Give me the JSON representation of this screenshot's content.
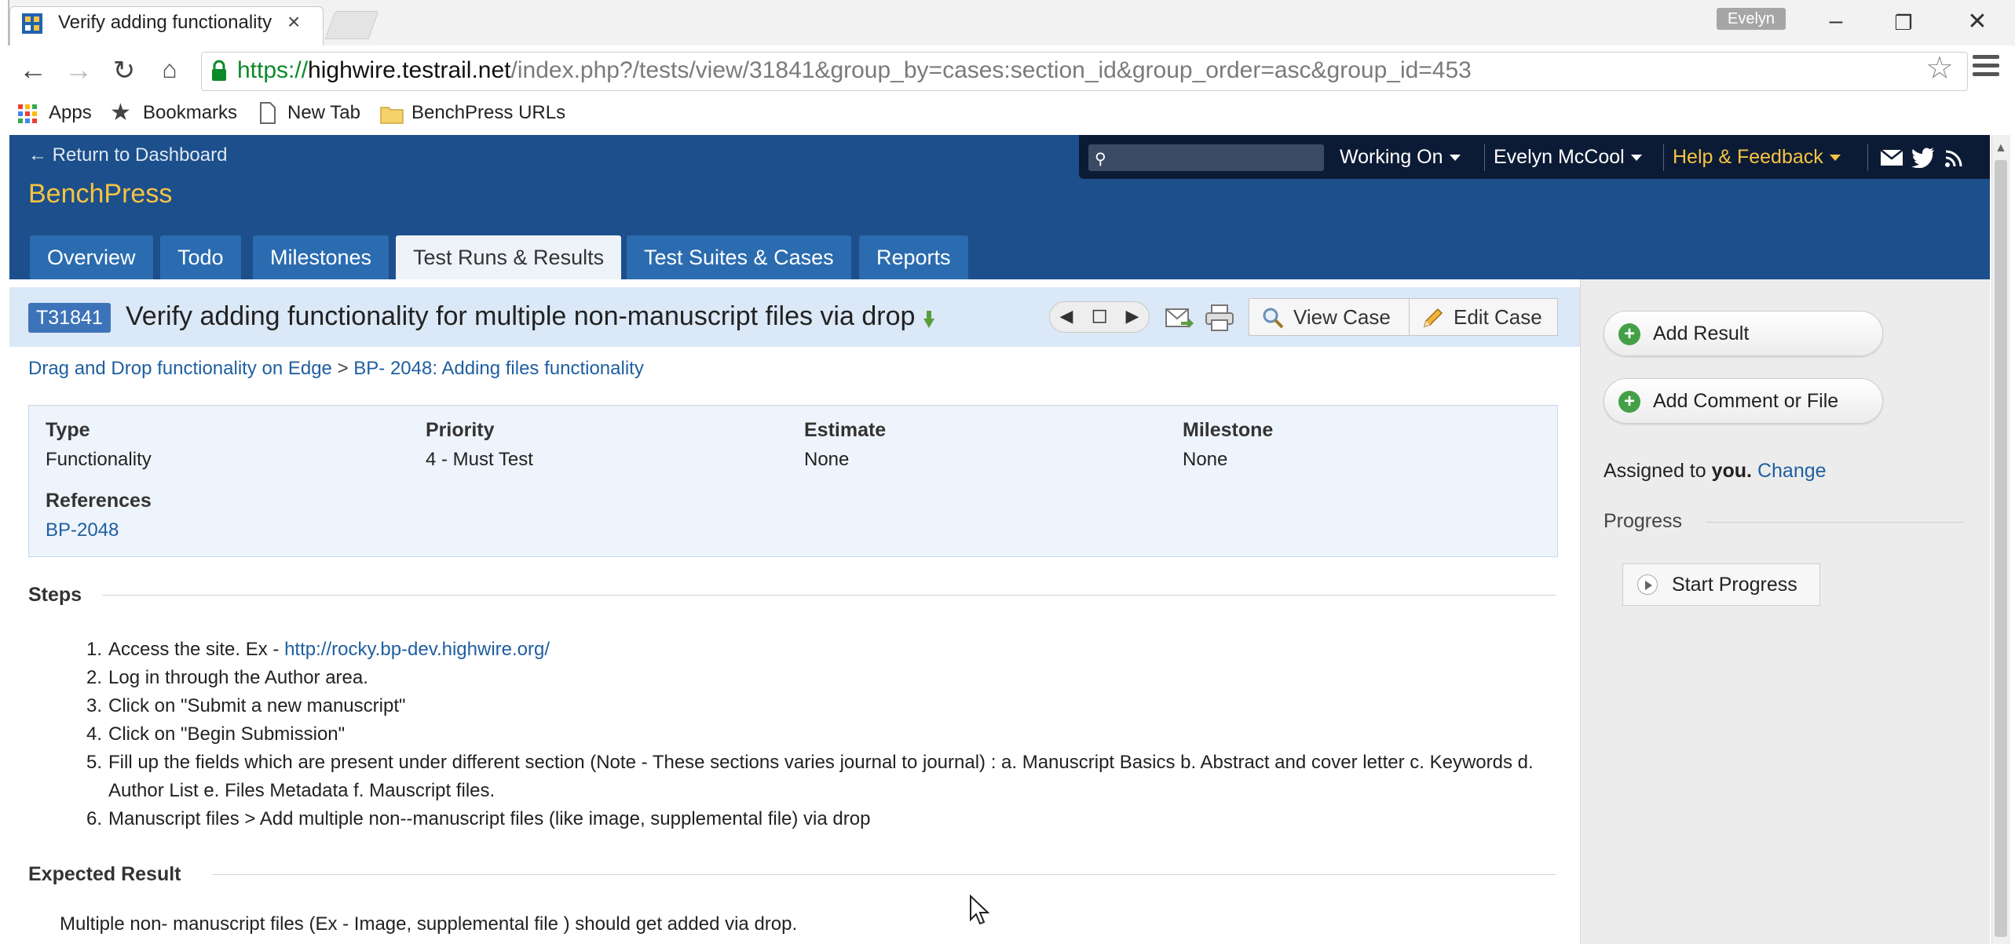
{
  "browser": {
    "tab_title": "Verify adding functionality",
    "profile_name": "Evelyn",
    "url_scheme": "https://",
    "url_host": "highwire.testrail.net",
    "url_path": "/index.php?/tests/view/31841&group_by=cases:section_id&group_order=asc&group_id=453",
    "bookmarks": {
      "apps": "Apps",
      "bookmarks": "Bookmarks",
      "new_tab": "New Tab",
      "benchpress_urls": "BenchPress URLs"
    }
  },
  "header": {
    "return_link": "← Return to Dashboard",
    "brand": "BenchPress",
    "search_placeholder": "",
    "working_on": "Working On",
    "user": "Evelyn McCool",
    "help": "Help & Feedback",
    "tabs": {
      "overview": "Overview",
      "todo": "Todo",
      "milestones": "Milestones",
      "test_runs": "Test Runs & Results",
      "test_suites": "Test Suites & Cases",
      "reports": "Reports"
    }
  },
  "test": {
    "id": "T31841",
    "title": "Verify adding functionality for multiple non-manuscript files via drop",
    "view_case": "View Case",
    "edit_case": "Edit Case",
    "breadcrumb": {
      "section": "Drag and Drop functionality on Edge",
      "separator": ">",
      "subsection": "BP- 2048: Adding files functionality"
    },
    "fields": {
      "type_label": "Type",
      "type_value": "Functionality",
      "priority_label": "Priority",
      "priority_value": "4 - Must Test",
      "estimate_label": "Estimate",
      "estimate_value": "None",
      "milestone_label": "Milestone",
      "milestone_value": "None",
      "references_label": "References",
      "references_value": "BP-2048"
    },
    "steps_label": "Steps",
    "steps": [
      {
        "num": "1.",
        "text": "Access the site. Ex - ",
        "link": "http://rocky.bp-dev.highwire.org/"
      },
      {
        "num": "2.",
        "text": "Log in through the Author area."
      },
      {
        "num": "3.",
        "text": "Click on \"Submit a new manuscript\""
      },
      {
        "num": "4.",
        "text": "Click on \"Begin Submission\""
      },
      {
        "num": "5.",
        "text": "Fill up the fields which are present under different section (Note - These sections varies journal to journal) : a. Manuscript Basics b. Abstract and cover letter c. Keywords d. Author List e. Files Metadata f. Mauscript files."
      },
      {
        "num": "6.",
        "text": "Manuscript files > Add multiple non--manuscript files (like image, supplemental file) via drop"
      }
    ],
    "expected_label": "Expected Result",
    "expected_text": "Multiple non- manuscript files (Ex - Image, supplemental file ) should get added via drop."
  },
  "sidebar": {
    "add_result": "Add Result",
    "add_comment": "Add Comment or File",
    "assigned_prefix": "Assigned to ",
    "assigned_you": "you.",
    "change": "Change",
    "progress_label": "Progress",
    "start_progress": "Start Progress"
  },
  "colors": {
    "header_bg": "#1c4f8b",
    "brand_accent": "#f6c342",
    "tab_bg": "#2b6cb0",
    "title_bar_bg": "#dbe8f7",
    "link": "#1f5fa0"
  }
}
